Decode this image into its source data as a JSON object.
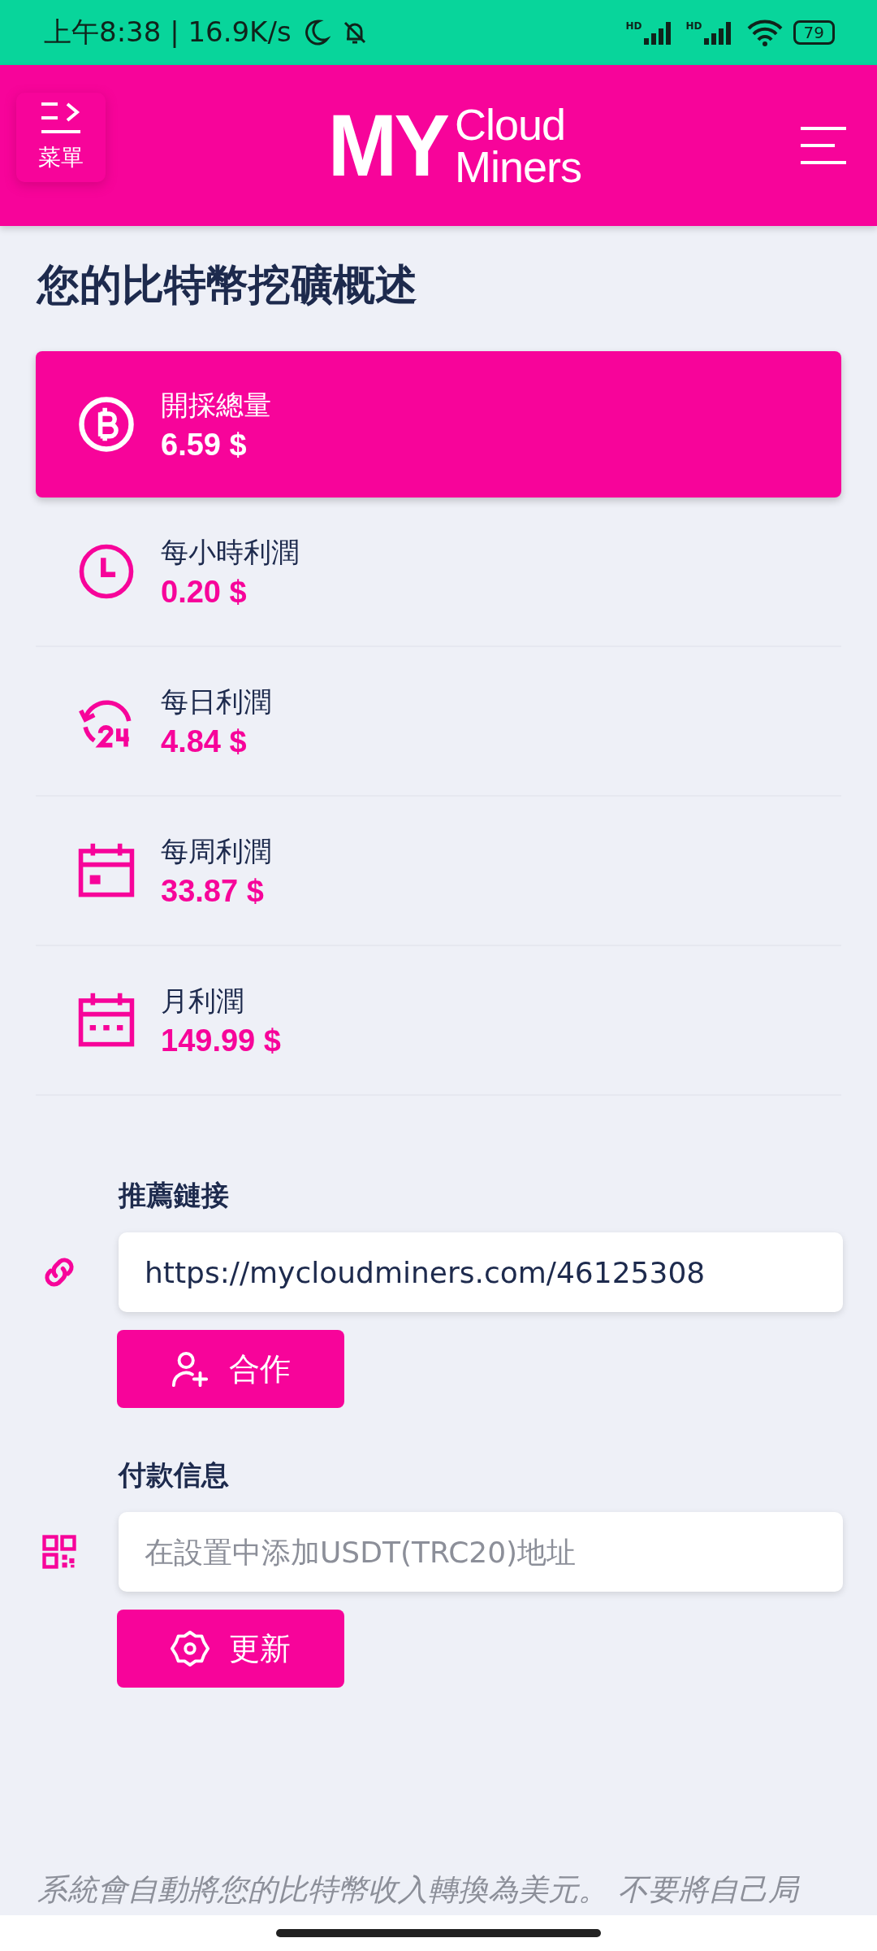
{
  "status_bar": {
    "time": "上午8:38 | 16.9K/s",
    "network_labels": [
      "HD",
      "HD"
    ],
    "battery": "79"
  },
  "header": {
    "menu_label": "菜單",
    "logo": {
      "mark": "MY",
      "line_1": "Cloud",
      "line_2": "Miners"
    }
  },
  "title": "您的比特幣挖礦概述",
  "stats": [
    {
      "kind": "coin",
      "label": "開採總量",
      "value": "6.59 $",
      "selected": true
    },
    {
      "kind": "clock",
      "label": "每小時利潤",
      "value": "0.20 $",
      "selected": false
    },
    {
      "kind": "day",
      "label": "每日利潤",
      "value": "4.84 $",
      "selected": false
    },
    {
      "kind": "week",
      "label": "每周利潤",
      "value": "33.87 $",
      "selected": false
    },
    {
      "kind": "month",
      "label": "月利潤",
      "value": "149.99 $",
      "selected": false
    }
  ],
  "sections": [
    {
      "kind": "link",
      "label": "推薦鏈接",
      "field": {
        "value": "https://mycloudminers.com/46125308"
      },
      "button": {
        "kind": "partner",
        "label": "合作"
      }
    },
    {
      "kind": "qr",
      "label": "付款信息",
      "field": {
        "placeholder": "在設置中添加USDT(TRC20)地址"
      },
      "button": {
        "kind": "settings",
        "label": "更新"
      }
    }
  ],
  "footer_note": "系統會自動將您的比特幣收入轉換為美元。 不要將自己局"
}
